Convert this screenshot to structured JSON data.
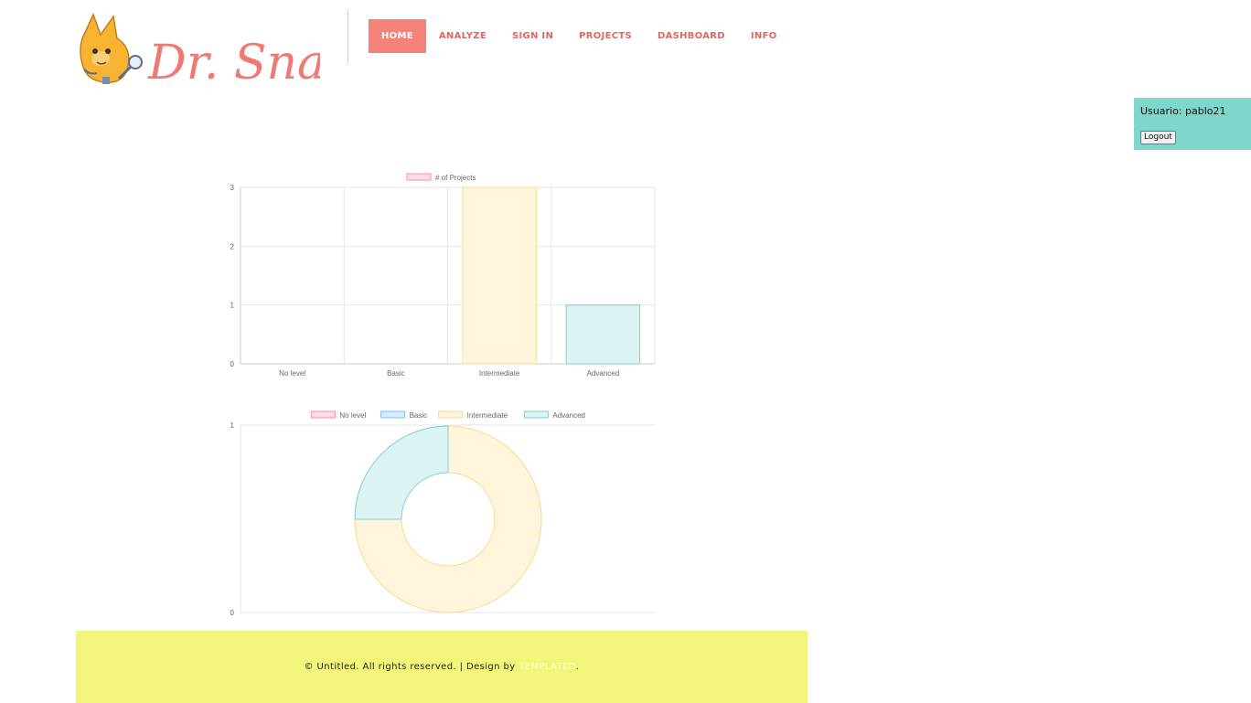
{
  "header": {
    "logo_text": "Dr. Snap!",
    "nav": [
      {
        "label": "HOME",
        "active": true
      },
      {
        "label": "ANALYZE",
        "active": false
      },
      {
        "label": "SIGN IN",
        "active": false
      },
      {
        "label": "PROJECTS",
        "active": false
      },
      {
        "label": "DASHBOARD",
        "active": false
      },
      {
        "label": "INFO",
        "active": false
      }
    ]
  },
  "user": {
    "label": "Usuario: pablo21",
    "logout_label": "Logout"
  },
  "colors": {
    "accent": "#f5817b",
    "user_box": "#7fd6ca",
    "footer": "#f2f57a"
  },
  "chart_data": [
    {
      "type": "bar",
      "legend": [
        "# of Projects"
      ],
      "legend_position": "top",
      "categories": [
        "No level",
        "Basic",
        "Intermediate",
        "Advanced"
      ],
      "series": [
        {
          "name": "# of Projects",
          "values": [
            0,
            0,
            3,
            1
          ]
        }
      ],
      "ylim": [
        0,
        3
      ],
      "yticks": [
        0,
        1,
        2,
        3
      ],
      "grid": true,
      "colors": {
        "fill": [
          "#ffdfe6",
          "#d7ebfb",
          "#fff5dc",
          "#dbf3f3"
        ],
        "stroke": [
          "#ff8fa8",
          "#7cc0ef",
          "#ffd98a",
          "#7fd0cf"
        ]
      }
    },
    {
      "type": "pie",
      "variant": "doughnut",
      "legend": [
        "No level",
        "Basic",
        "Intermediate",
        "Advanced"
      ],
      "legend_position": "top",
      "values": [
        0,
        0,
        3,
        1
      ],
      "yticks": [
        0,
        1
      ],
      "grid": true,
      "colors": {
        "fill": [
          "#ffdfe6",
          "#d7ebfb",
          "#fff5dc",
          "#dbf3f3"
        ],
        "stroke": [
          "#ff8fa8",
          "#7cc0ef",
          "#ffd98a",
          "#7fd0cf"
        ]
      }
    }
  ],
  "footer": {
    "copyright": "© Untitled. All rights reserved. | Design by",
    "link_label": "TEMPLATED",
    "suffix": "."
  }
}
